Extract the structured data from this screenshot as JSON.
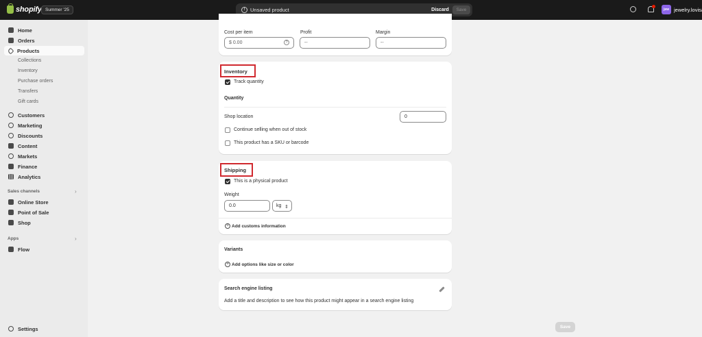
{
  "topbar": {
    "logo_text": "shopify",
    "edition": "Summer '25",
    "unsaved_label": "Unsaved product",
    "discard_label": "Discard",
    "save_label": "Save",
    "avatar_initials": "jew",
    "account_name": "jewelry.lovisa"
  },
  "sidebar": {
    "items": [
      {
        "label": "Home",
        "icon": "home-icon"
      },
      {
        "label": "Orders",
        "icon": "inbox-icon"
      },
      {
        "label": "Products",
        "icon": "tag-icon"
      },
      {
        "label": "Customers",
        "icon": "person-icon"
      },
      {
        "label": "Marketing",
        "icon": "target-icon"
      },
      {
        "label": "Discounts",
        "icon": "discount-icon"
      },
      {
        "label": "Content",
        "icon": "content-icon"
      },
      {
        "label": "Markets",
        "icon": "globe-icon"
      },
      {
        "label": "Finance",
        "icon": "bank-icon"
      },
      {
        "label": "Analytics",
        "icon": "chart-icon"
      }
    ],
    "product_subitems": [
      "Collections",
      "Inventory",
      "Purchase orders",
      "Transfers",
      "Gift cards"
    ],
    "sales_channels_label": "Sales channels",
    "sales_channels": [
      "Online Store",
      "Point of Sale",
      "Shop"
    ],
    "apps_label": "Apps",
    "apps": [
      "Flow"
    ],
    "settings_label": "Settings"
  },
  "pricing": {
    "cost_label": "Cost per item",
    "cost_value": "$ 0.00",
    "profit_label": "Profit",
    "profit_value": "--",
    "margin_label": "Margin",
    "margin_value": "--"
  },
  "inventory": {
    "title": "Inventory",
    "track_quantity": "Track quantity",
    "quantity_title": "Quantity",
    "shop_location": "Shop location",
    "location_qty": "0",
    "continue_selling": "Continue selling when out of stock",
    "has_sku": "This product has a SKU or barcode"
  },
  "shipping": {
    "title": "Shipping",
    "physical_product": "This is a physical product",
    "weight_label": "Weight",
    "weight_value": "0.0",
    "weight_unit": "kg",
    "add_customs": "Add customs information"
  },
  "variants": {
    "title": "Variants",
    "add_options": "Add options like size or color"
  },
  "seo": {
    "title": "Search engine listing",
    "description": "Add a title and description to see how this product might appear in a search engine listing"
  },
  "footer": {
    "save_label": "Save"
  },
  "colors": {
    "highlight": "#d0282e",
    "topbar": "#1a1a1a",
    "avatar": "#8d66e8"
  }
}
